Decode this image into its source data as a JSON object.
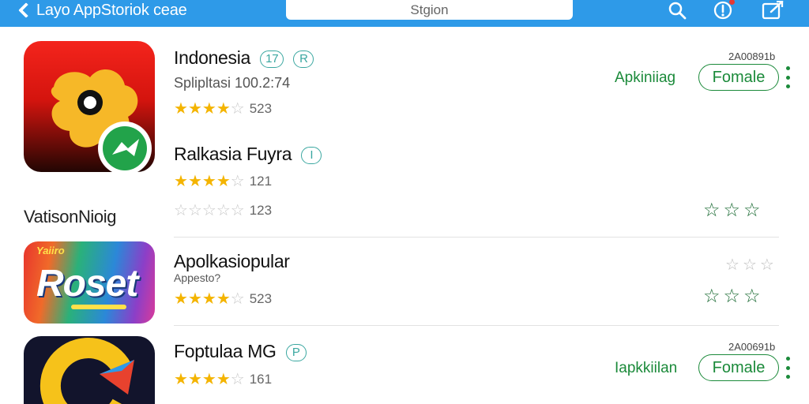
{
  "topbar": {
    "back_label": "Layo AppStoriok ceae",
    "search_placeholder": "Stgion",
    "icons": [
      "search-icon",
      "info-icon",
      "edit-icon"
    ],
    "accent": "#2e9ae8"
  },
  "section": {
    "label": "VatisonNioig"
  },
  "apps": [
    {
      "title": "Indonesia",
      "tags": [
        "17",
        "R"
      ],
      "subtitle": "Splipltasi 100.2:74",
      "rating": 4.5,
      "rating_count": "523",
      "version": "2A00891b",
      "status": "Apkiniiag",
      "button": "Fomale",
      "icon": "puzzle-app-icon"
    },
    {
      "title": "Ralkasia Fuyra",
      "tags": [
        "I"
      ],
      "subtitle": "",
      "rating": 4,
      "rating_count": "121",
      "secondary_rating_count": "123",
      "right_stars": 3
    },
    {
      "title": "Apolkasiopular",
      "subtitle": "Appesto?",
      "rating": 4.5,
      "rating_count": "523",
      "icon": "roset-app-icon",
      "icon_text": "Roset",
      "icon_small_text": "Yaiiro",
      "right_stars_gray": 3,
      "right_stars": 3
    },
    {
      "title": "Foptulaa MG",
      "tags": [
        "P"
      ],
      "rating": 4,
      "rating_count": "161",
      "version": "2A00691b",
      "status": "Iapkkiilan",
      "button": "Fomale",
      "icon": "c-logo-app-icon"
    }
  ],
  "colors": {
    "green": "#1b8a3a",
    "star": "#f4b400",
    "teal": "#3aa7a0"
  }
}
